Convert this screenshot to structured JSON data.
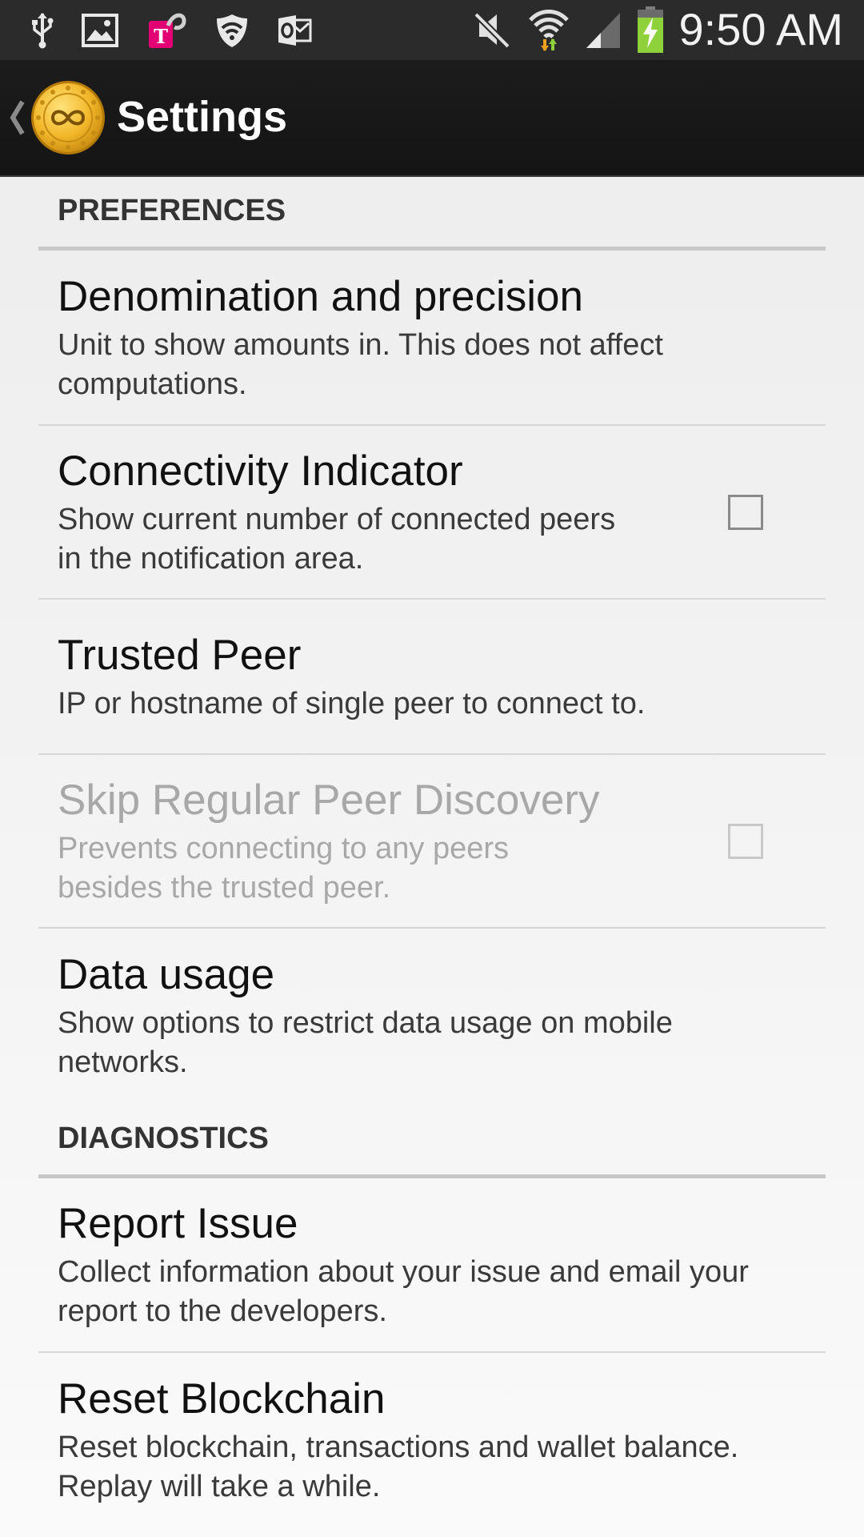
{
  "status_bar": {
    "left_icons": [
      "usb-icon",
      "image-icon",
      "t-mobile-icon",
      "shield-icon",
      "outlook-icon"
    ],
    "right_icons": [
      "mute-icon",
      "wifi-icon",
      "signal-icon",
      "battery-charging-icon"
    ],
    "time": "9:50 AM"
  },
  "action_bar": {
    "title": "Settings",
    "logo_icon": "coin-logo-icon",
    "up_icon": "chevron-left-icon"
  },
  "colors": {
    "logo_gold": "#f2b72a",
    "battery_green": "#8ed13a",
    "t_mobile_magenta": "#e20074"
  },
  "sections": {
    "preferences": {
      "header": "PREFERENCES",
      "items": [
        {
          "title": "Denomination and precision",
          "summary": "Unit to show amounts in. This does not affect computations."
        },
        {
          "title": "Connectivity Indicator",
          "summary": "Show current number of connected peers in the notification area.",
          "checked": false
        },
        {
          "title": "Trusted Peer",
          "summary": "IP or hostname of single peer to connect to."
        },
        {
          "title": "Skip Regular Peer Discovery",
          "summary": "Prevents connecting to any peers besides the trusted peer.",
          "checked": false,
          "enabled": false
        },
        {
          "title": "Data usage",
          "summary": "Show options to restrict data usage on mobile networks."
        }
      ]
    },
    "diagnostics": {
      "header": "DIAGNOSTICS",
      "items": [
        {
          "title": "Report Issue",
          "summary": "Collect information about your issue and email your report to the developers."
        },
        {
          "title": "Reset Blockchain",
          "summary": "Reset blockchain, transactions and wallet balance. Replay will take a while."
        }
      ]
    }
  }
}
